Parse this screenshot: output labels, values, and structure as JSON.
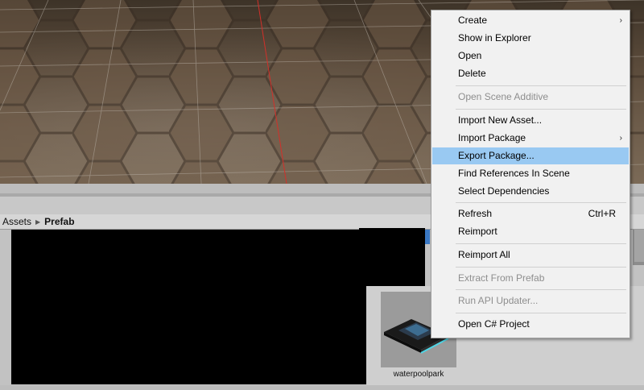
{
  "breadcrumb": {
    "root": "Assets",
    "separator": "▶",
    "current": "Prefab"
  },
  "asset": {
    "label": "waterpoolpark"
  },
  "context_menu": {
    "items": [
      {
        "label": "Create",
        "submenu": true,
        "enabled": true
      },
      {
        "label": "Show in Explorer",
        "enabled": true
      },
      {
        "label": "Open",
        "enabled": true
      },
      {
        "label": "Delete",
        "enabled": true
      },
      {
        "label": "Open Scene Additive",
        "enabled": false
      },
      {
        "label": "Import New Asset...",
        "enabled": true
      },
      {
        "label": "Import Package",
        "submenu": true,
        "enabled": true
      },
      {
        "label": "Export Package...",
        "enabled": true,
        "highlighted": true
      },
      {
        "label": "Find References In Scene",
        "enabled": true
      },
      {
        "label": "Select Dependencies",
        "enabled": true
      },
      {
        "label": "Refresh",
        "shortcut": "Ctrl+R",
        "enabled": true
      },
      {
        "label": "Reimport",
        "enabled": true
      },
      {
        "label": "Reimport All",
        "enabled": true
      },
      {
        "label": "Extract From Prefab",
        "enabled": false
      },
      {
        "label": "Run API Updater...",
        "enabled": false
      },
      {
        "label": "Open C# Project",
        "enabled": true
      }
    ],
    "submenu_arrow": "›"
  },
  "colors": {
    "highlight": "#99c9f2",
    "disabled_text": "#8e8e8e"
  }
}
